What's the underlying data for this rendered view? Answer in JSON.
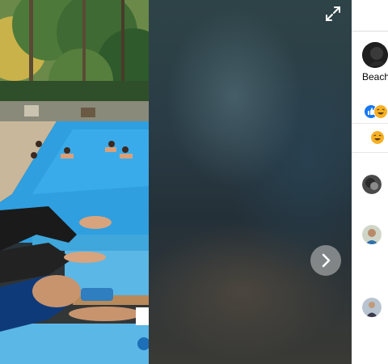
{
  "viewer": {
    "expand_icon": "expand-arrows-icon",
    "next_icon": "chevron-right-icon"
  },
  "sidebar": {
    "page_name": "Beach",
    "reactions": [
      "like-icon",
      "haha-icon"
    ],
    "comment_emoji": "haha-icon",
    "commenters": [
      "commenter-avatar-1",
      "commenter-avatar-2",
      "commenter-avatar-3"
    ]
  },
  "colors": {
    "like_blue": "#1877f2",
    "haha_yellow": "#f7b125",
    "next_button": "#c8c8c8"
  }
}
